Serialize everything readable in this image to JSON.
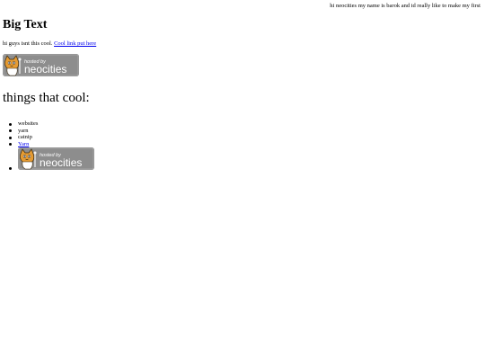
{
  "marquee": {
    "text": "hi neocities my name is barok and id really like to make my first"
  },
  "header": {
    "title": "Big Text"
  },
  "intro": {
    "text": "hi guys isnt this cool.",
    "link_label": "Cool link put here"
  },
  "badge": {
    "line1": "hosted by",
    "line2": "neocities"
  },
  "section": {
    "title": "things that cool:"
  },
  "list": {
    "items": [
      {
        "label": "websites"
      },
      {
        "label": "yarn"
      },
      {
        "label": "catnip"
      },
      {
        "label": "Yarn"
      }
    ]
  },
  "colors": {
    "link": "#0000ee",
    "badge_bg": "#8d8d8d",
    "badge_text": "#ffffff",
    "cat_orange": "#e59b33"
  },
  "icons": [
    "neocities-cat-icon",
    "bullet-icon"
  ]
}
